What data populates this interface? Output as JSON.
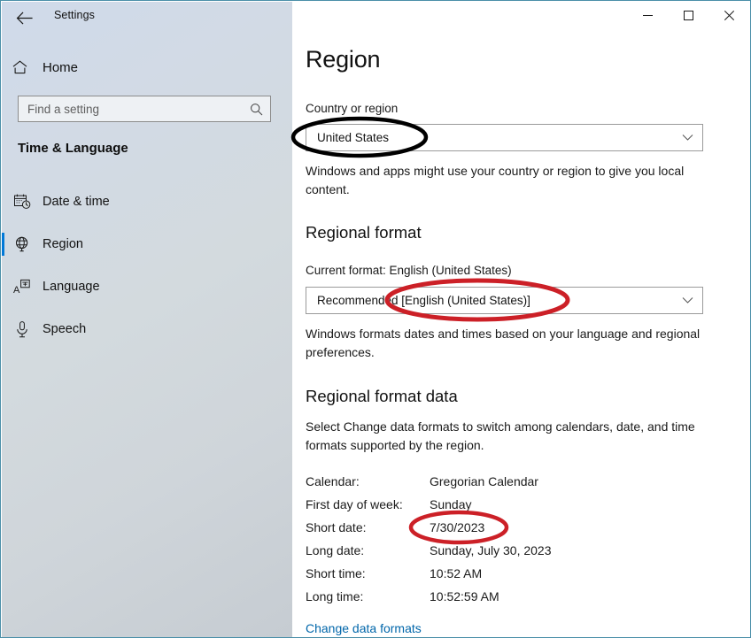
{
  "window": {
    "title": "Settings",
    "back_icon": "back-arrow-icon",
    "minimize_label": "Minimize",
    "maximize_label": "Maximize",
    "close_label": "Close",
    "border_color": "#4a8fa8"
  },
  "sidebar": {
    "home_label": "Home",
    "home_icon": "home-icon",
    "search": {
      "placeholder": "Find a setting",
      "value": "Find a setting",
      "icon": "search-icon"
    },
    "section_title": "Time & Language",
    "items": [
      {
        "label": "Date & time",
        "icon": "calendar-clock-icon",
        "selected": false
      },
      {
        "label": "Region",
        "icon": "globe-icon",
        "selected": true
      },
      {
        "label": "Language",
        "icon": "language-icon",
        "selected": false
      },
      {
        "label": "Speech",
        "icon": "microphone-icon",
        "selected": false
      }
    ],
    "selection_color": "#0078d7"
  },
  "main": {
    "page_title": "Region",
    "country": {
      "label": "Country or region",
      "value": "United States",
      "description": "Windows and apps might use your country or region to give you local content.",
      "chevron_icon": "chevron-down-icon"
    },
    "regional_format": {
      "heading": "Regional format",
      "current_format": "Current format: English (United States)",
      "value": "Recommended [English (United States)]",
      "description": "Windows formats dates and times based on your language and regional preferences.",
      "chevron_icon": "chevron-down-icon"
    },
    "regional_format_data": {
      "heading": "Regional format data",
      "description": "Select Change data formats to switch among calendars, date, and time formats supported by the region.",
      "rows": [
        {
          "label": "Calendar:",
          "value": "Gregorian Calendar"
        },
        {
          "label": "First day of week:",
          "value": "Sunday"
        },
        {
          "label": "Short date:",
          "value": "7/30/2023"
        },
        {
          "label": "Long date:",
          "value": "Sunday, July 30, 2023"
        },
        {
          "label": "Short time:",
          "value": "10:52 AM"
        },
        {
          "label": "Long time:",
          "value": "10:52:59 AM"
        }
      ],
      "change_link": "Change data formats",
      "link_color": "#0066aa"
    }
  },
  "annotations": [
    {
      "name": "country-ellipse",
      "color": "#000000",
      "target": "United States"
    },
    {
      "name": "regional-format-ellipse",
      "color": "#cc2027",
      "target": "[English (United States)]"
    },
    {
      "name": "short-date-ellipse",
      "color": "#cc2027",
      "target": "7/30/2023"
    }
  ]
}
